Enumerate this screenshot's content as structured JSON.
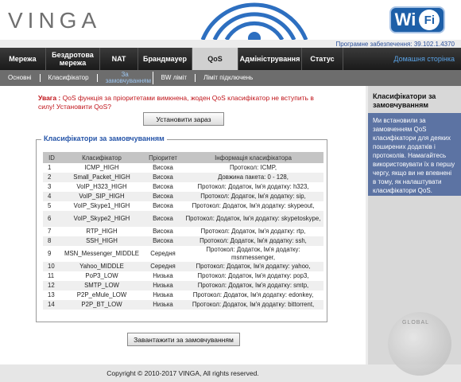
{
  "header": {
    "logo": "VINGA",
    "wifi_badge_left": "Wi",
    "wifi_badge_right": "Fi",
    "firmware": "Програмне забезпечення: 39.102.1.4370"
  },
  "mainnav": {
    "tabs": [
      {
        "label": "Мережа"
      },
      {
        "label": "Бездротова мережа"
      },
      {
        "label": "NAT"
      },
      {
        "label": "Брандмауер"
      },
      {
        "label": "QoS"
      },
      {
        "label": "Адміністрування"
      },
      {
        "label": "Статус"
      }
    ],
    "active_tab": "QoS",
    "home_link": "Домашня сторінка"
  },
  "subnav": {
    "items": [
      {
        "label": "Основні"
      },
      {
        "label": "Класифікатор"
      },
      {
        "label": "За замовчуванням"
      },
      {
        "label": "BW ліміт"
      },
      {
        "label": "Ліміт підключень"
      }
    ],
    "active_item": "За замовчуванням"
  },
  "main": {
    "warning_prefix": "Увага :",
    "warning_text": "QoS функція за пріоритетами вимкнена, жоден QoS класифікатор не вступить в силу! Установити QoS?",
    "install_button": "Установити зараз",
    "fieldset_title": "Класифікатори за замовчуванням",
    "table": {
      "headers": [
        "ID",
        "Класифікатор",
        "Пріоритет",
        "Інформація класифікатора"
      ],
      "rows": [
        {
          "id": "1",
          "name": "ICMP_HIGH",
          "priority": "Висока",
          "info": "Протокол: ICMP,"
        },
        {
          "id": "2",
          "name": "Small_Packet_HIGH",
          "priority": "Висока",
          "info": "Довжина пакета: 0 - 128,"
        },
        {
          "id": "3",
          "name": "VoIP_H323_HIGH",
          "priority": "Висока",
          "info": "Протокол: Додаток, Ім'я додатку: h323,"
        },
        {
          "id": "4",
          "name": "VoIP_SIP_HIGH",
          "priority": "Висока",
          "info": "Протокол: Додаток, Ім'я додатку: sip,"
        },
        {
          "id": "5",
          "name": "VoIP_Skype1_HIGH",
          "priority": "Висока",
          "info": "Протокол: Додаток, Ім'я додатку: skypeout,"
        },
        {
          "id": "6",
          "name": "VoIP_Skype2_HIGH",
          "priority": "Висока",
          "info": "Протокол: Додаток, Ім'я додатку: skypetoskype,"
        },
        {
          "id": "7",
          "name": "RTP_HIGH",
          "priority": "Висока",
          "info": "Протокол: Додаток, Ім'я додатку: rtp,"
        },
        {
          "id": "8",
          "name": "SSH_HIGH",
          "priority": "Висока",
          "info": "Протокол: Додаток, Ім'я додатку: ssh,"
        },
        {
          "id": "9",
          "name": "MSN_Messenger_MIDDLE",
          "priority": "Середня",
          "info": "Протокол: Додаток, Ім'я додатку: msnmessenger,"
        },
        {
          "id": "10",
          "name": "Yahoo_MIDDLE",
          "priority": "Середня",
          "info": "Протокол: Додаток, Ім'я додатку: yahoo,"
        },
        {
          "id": "11",
          "name": "PoP3_LOW",
          "priority": "Низька",
          "info": "Протокол: Додаток, Ім'я додатку: pop3,"
        },
        {
          "id": "12",
          "name": "SMTP_LOW",
          "priority": "Низька",
          "info": "Протокол: Додаток, Ім'я додатку: smtp,"
        },
        {
          "id": "13",
          "name": "P2P_eMule_LOW",
          "priority": "Низька",
          "info": "Протокол: Додаток, Ім'я додатку: edonkey,"
        },
        {
          "id": "14",
          "name": "P2P_BT_LOW",
          "priority": "Низька",
          "info": "Протокол: Додаток, Ім'я додатку: bittorrent,"
        }
      ]
    },
    "load_default_button": "Завантажити за замовчуванням"
  },
  "sidepanel": {
    "title": "Класифікатори за замовчуванням",
    "body": "Ми встановили за замовченням QoS класифікатори для деяких поширених додатків і протоколів. Намагайтесь використовувати їх в першу чергу, якщо ви не впевнені в тому, як налаштувати класифікатори QoS."
  },
  "footer": {
    "copyright": "Copyright © 2010-2017 VINGA, All rights reserved."
  },
  "watermark": {
    "text": "GLOBAL"
  },
  "colors": {
    "warning": "#c0141a",
    "link_blue": "#2554a8",
    "side_body": "#5c73a3",
    "nav_dark": "#1a1a1a"
  }
}
